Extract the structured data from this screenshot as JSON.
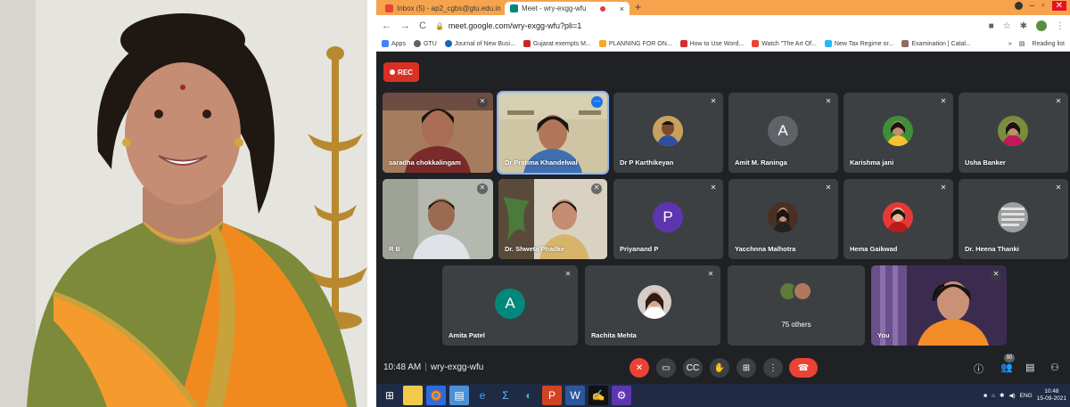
{
  "browser": {
    "tabs": [
      {
        "label": "Inbox (5) - ap2_cgbs@gtu.edu.in",
        "active": false,
        "close": "×"
      },
      {
        "label": "Meet - wry-exgg-wfu",
        "active": true,
        "close": "×"
      }
    ],
    "new_tab": "+",
    "url": "meet.google.com/wry-exgg-wfu?pli=1",
    "bookmarks": [
      {
        "label": "Apps",
        "icon": "apps-grid-icon",
        "color": "#4285f4"
      },
      {
        "label": "GTU",
        "icon": "globe-icon",
        "color": "#5f6368"
      },
      {
        "label": "Journal of New Busi...",
        "icon": "journal-icon",
        "color": "#1565c0"
      },
      {
        "label": "Gujarat exempts M...",
        "icon": "ts-icon",
        "color": "#c62828"
      },
      {
        "label": "PLANNING FOR ON...",
        "icon": "planning-icon",
        "color": "#f9a825"
      },
      {
        "label": "How to Use Word...",
        "icon": "b-icon",
        "color": "#d32f2f"
      },
      {
        "label": "Watch \"The Art Of...",
        "icon": "gmail-icon",
        "color": "#ea4335"
      },
      {
        "label": "New Tax Regime or...",
        "icon": "telegram-icon",
        "color": "#29b6f6"
      },
      {
        "label": "Examination | Catal...",
        "icon": "exam-icon",
        "color": "#8d6e63"
      }
    ],
    "bookmarks_more": "»",
    "reading_list": "Reading list"
  },
  "meet": {
    "rec_label": "REC",
    "participants": [
      {
        "name": "saradha chokkalingam",
        "kind": "video"
      },
      {
        "name": "Dr Pratima Khandelwal",
        "kind": "video"
      },
      {
        "name": "Dr P Karthikeyan",
        "kind": "photo"
      },
      {
        "name": "Amit M. Raninga",
        "kind": "letter",
        "letter": "A",
        "color": "#5f6368"
      },
      {
        "name": "Karishma jani",
        "kind": "photo"
      },
      {
        "name": "Usha Banker",
        "kind": "photo"
      },
      {
        "name": "R B",
        "kind": "video"
      },
      {
        "name": "Dr. Shweta Phadke",
        "kind": "video"
      },
      {
        "name": "Priyanand P",
        "kind": "letter",
        "letter": "P",
        "color": "#5e35b1"
      },
      {
        "name": "Yacchnna Malhotra",
        "kind": "photo"
      },
      {
        "name": "Hema Gaikwad",
        "kind": "photo"
      },
      {
        "name": "Dr. Heena Thanki",
        "kind": "photo"
      },
      {
        "name": "Amita Patel",
        "kind": "letter",
        "letter": "A",
        "color": "#00897b"
      },
      {
        "name": "Rachita Mehta",
        "kind": "photo"
      },
      {
        "name": "75 others",
        "kind": "others"
      },
      {
        "name": "You",
        "kind": "video"
      }
    ],
    "time": "10:48 AM",
    "meeting_code": "wry-exgg-wfu",
    "people_count": "90"
  },
  "taskbar": {
    "lang": "ENG",
    "time": "10:48",
    "date": "15-09-2021"
  }
}
